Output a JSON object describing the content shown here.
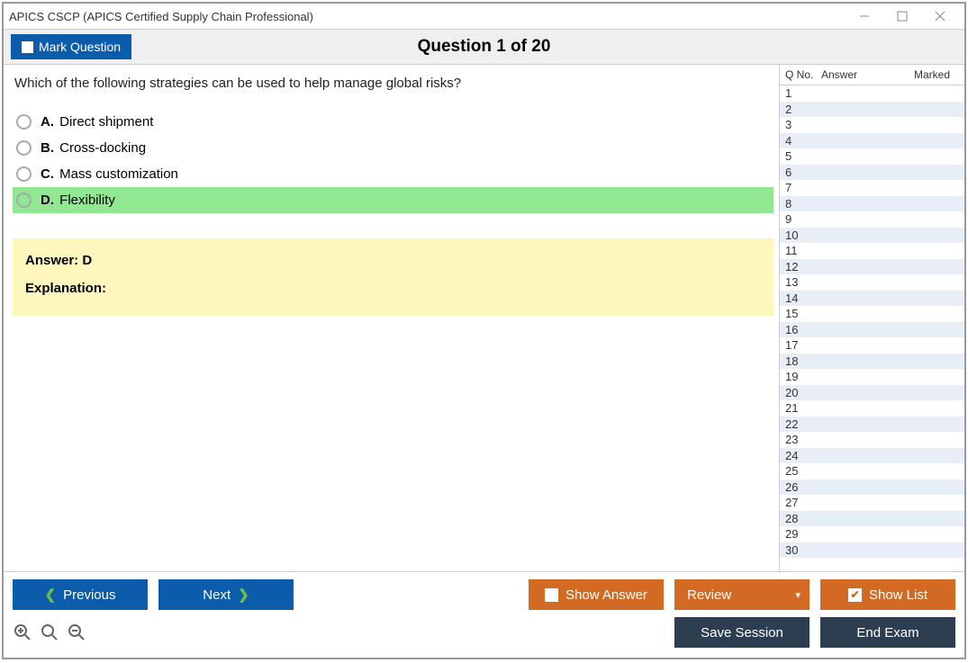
{
  "window": {
    "title": "APICS CSCP (APICS Certified Supply Chain Professional)"
  },
  "header": {
    "mark_label": "Mark Question",
    "question_title": "Question 1 of 20"
  },
  "question": {
    "text": "Which of the following strategies can be used to help manage global risks?",
    "choices": [
      {
        "letter": "A.",
        "text": "Direct shipment",
        "correct": false
      },
      {
        "letter": "B.",
        "text": "Cross-docking",
        "correct": false
      },
      {
        "letter": "C.",
        "text": "Mass customization",
        "correct": false
      },
      {
        "letter": "D.",
        "text": "Flexibility",
        "correct": true
      }
    ],
    "answer_label": "Answer: D",
    "explanation_label": "Explanation:"
  },
  "side": {
    "headers": {
      "qno": "Q No.",
      "answer": "Answer",
      "marked": "Marked"
    },
    "rows": [
      "1",
      "2",
      "3",
      "4",
      "5",
      "6",
      "7",
      "8",
      "9",
      "10",
      "11",
      "12",
      "13",
      "14",
      "15",
      "16",
      "17",
      "18",
      "19",
      "20",
      "21",
      "22",
      "23",
      "24",
      "25",
      "26",
      "27",
      "28",
      "29",
      "30"
    ]
  },
  "footer": {
    "previous": "Previous",
    "next": "Next",
    "show_answer": "Show Answer",
    "review": "Review",
    "show_list": "Show List",
    "save_session": "Save Session",
    "end_exam": "End Exam"
  }
}
